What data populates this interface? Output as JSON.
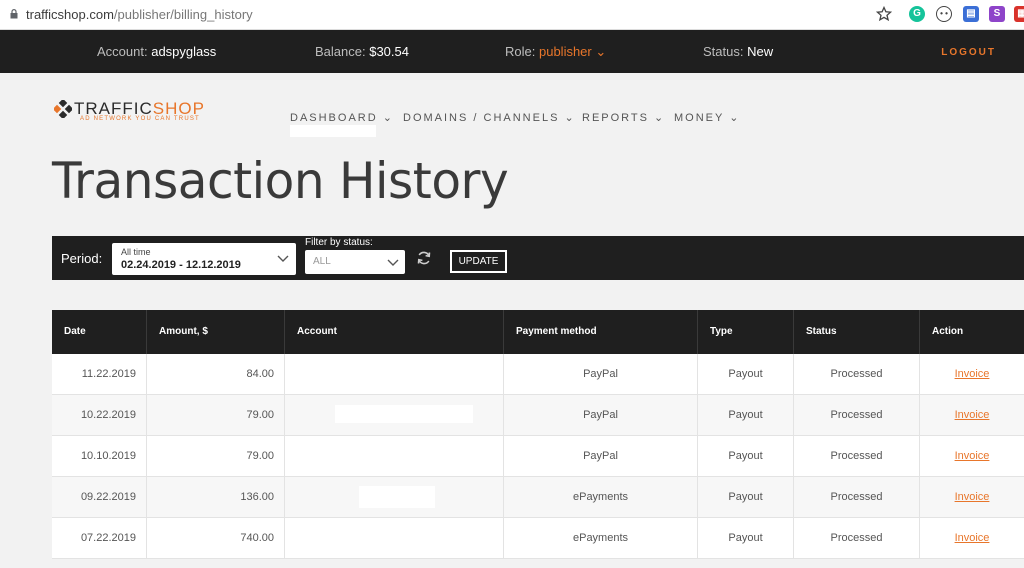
{
  "browser": {
    "url_host": "trafficshop.com",
    "url_path": "/publisher/billing_history",
    "extension_icons": [
      "star-icon",
      "grammarly-icon",
      "face-icon",
      "card-icon",
      "s-icon",
      "calendar-icon"
    ]
  },
  "account_bar": {
    "account_label": "Account:",
    "account_value": "adspyglass",
    "balance_label": "Balance:",
    "balance_value": "$30.54",
    "role_label": "Role:",
    "role_value": "publisher",
    "status_label": "Status:",
    "status_value": "New",
    "logout": "LOGOUT"
  },
  "brand": {
    "name_part1": "TRAFFIC",
    "name_part2": "SHOP",
    "tagline": "AD NETWORK YOU CAN TRUST",
    "accent": "#e8762b"
  },
  "nav": {
    "items": [
      "DASHBOARD",
      "DOMAINS / CHANNELS",
      "REPORTS",
      "MONEY"
    ]
  },
  "page": {
    "title": "Transaction History"
  },
  "filters": {
    "period_label": "Period:",
    "period_preset": "All time",
    "period_range": "02.24.2019 - 12.12.2019",
    "status_label": "Filter by status:",
    "status_value": "ALL",
    "update_label": "UPDATE"
  },
  "table": {
    "columns": [
      "Date",
      "Amount, $",
      "Account",
      "Payment method",
      "Type",
      "Status",
      "Action"
    ],
    "rows": [
      {
        "date": "11.22.2019",
        "amount": "84.00",
        "method": "PayPal",
        "type": "Payout",
        "status": "Processed",
        "action": "Invoice"
      },
      {
        "date": "10.22.2019",
        "amount": "79.00",
        "method": "PayPal",
        "type": "Payout",
        "status": "Processed",
        "action": "Invoice"
      },
      {
        "date": "10.10.2019",
        "amount": "79.00",
        "method": "PayPal",
        "type": "Payout",
        "status": "Processed",
        "action": "Invoice"
      },
      {
        "date": "09.22.2019",
        "amount": "136.00",
        "method": "ePayments",
        "type": "Payout",
        "status": "Processed",
        "action": "Invoice"
      },
      {
        "date": "07.22.2019",
        "amount": "740.00",
        "method": "ePayments",
        "type": "Payout",
        "status": "Processed",
        "action": "Invoice"
      }
    ]
  }
}
